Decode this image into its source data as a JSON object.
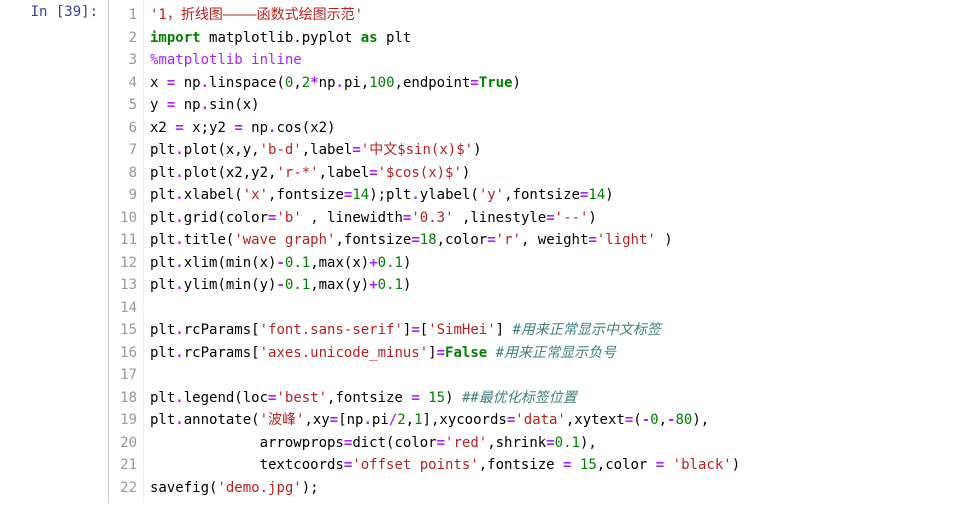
{
  "prompt": {
    "label": "In [39]:"
  },
  "gutter": [
    "1",
    "2",
    "3",
    "4",
    "5",
    "6",
    "7",
    "8",
    "9",
    "10",
    "11",
    "12",
    "13",
    "14",
    "15",
    "16",
    "17",
    "18",
    "19",
    "20",
    "21",
    "22"
  ],
  "lines": [
    [
      {
        "t": "'1，折线图————函数式绘图示范'",
        "c": "tok-str"
      }
    ],
    [
      {
        "t": "import",
        "c": "tok-kw"
      },
      {
        "t": " "
      },
      {
        "t": "matplotlib.pyplot",
        "c": "tok-name"
      },
      {
        "t": " "
      },
      {
        "t": "as",
        "c": "tok-kw"
      },
      {
        "t": " "
      },
      {
        "t": "plt",
        "c": "tok-name"
      }
    ],
    [
      {
        "t": "%",
        "c": "tok-mag"
      },
      {
        "t": "matplotlib",
        "c": "tok-mag"
      },
      {
        "t": " inline",
        "c": "tok-mag"
      }
    ],
    [
      {
        "t": "x "
      },
      {
        "t": "=",
        "c": "tok-op"
      },
      {
        "t": " np"
      },
      {
        "t": ".",
        "c": "tok-op"
      },
      {
        "t": "linspace("
      },
      {
        "t": "0",
        "c": "tok-num"
      },
      {
        "t": ","
      },
      {
        "t": "2",
        "c": "tok-num"
      },
      {
        "t": "*",
        "c": "tok-op"
      },
      {
        "t": "np"
      },
      {
        "t": ".",
        "c": "tok-op"
      },
      {
        "t": "pi,"
      },
      {
        "t": "100",
        "c": "tok-num"
      },
      {
        "t": ",endpoint"
      },
      {
        "t": "=",
        "c": "tok-op"
      },
      {
        "t": "True",
        "c": "tok-bool"
      },
      {
        "t": ")"
      }
    ],
    [
      {
        "t": "y "
      },
      {
        "t": "=",
        "c": "tok-op"
      },
      {
        "t": " np"
      },
      {
        "t": ".",
        "c": "tok-op"
      },
      {
        "t": "sin(x)"
      }
    ],
    [
      {
        "t": "x2 "
      },
      {
        "t": "=",
        "c": "tok-op"
      },
      {
        "t": " x;y2 "
      },
      {
        "t": "=",
        "c": "tok-op"
      },
      {
        "t": " np"
      },
      {
        "t": ".",
        "c": "tok-op"
      },
      {
        "t": "cos(x2)"
      }
    ],
    [
      {
        "t": "plt"
      },
      {
        "t": ".",
        "c": "tok-op"
      },
      {
        "t": "plot(x,y,"
      },
      {
        "t": "'b-d'",
        "c": "tok-str"
      },
      {
        "t": ",label"
      },
      {
        "t": "=",
        "c": "tok-op"
      },
      {
        "t": "'中文$sin(x)$'",
        "c": "tok-str"
      },
      {
        "t": ")"
      }
    ],
    [
      {
        "t": "plt"
      },
      {
        "t": ".",
        "c": "tok-op"
      },
      {
        "t": "plot(x2,y2,"
      },
      {
        "t": "'r-*'",
        "c": "tok-str"
      },
      {
        "t": ",label"
      },
      {
        "t": "=",
        "c": "tok-op"
      },
      {
        "t": "'$cos(x)$'",
        "c": "tok-str"
      },
      {
        "t": ")"
      }
    ],
    [
      {
        "t": "plt"
      },
      {
        "t": ".",
        "c": "tok-op"
      },
      {
        "t": "xlabel("
      },
      {
        "t": "'x'",
        "c": "tok-str"
      },
      {
        "t": ",fontsize"
      },
      {
        "t": "=",
        "c": "tok-op"
      },
      {
        "t": "14",
        "c": "tok-num"
      },
      {
        "t": ");plt"
      },
      {
        "t": ".",
        "c": "tok-op"
      },
      {
        "t": "ylabel("
      },
      {
        "t": "'y'",
        "c": "tok-str"
      },
      {
        "t": ",fontsize"
      },
      {
        "t": "=",
        "c": "tok-op"
      },
      {
        "t": "14",
        "c": "tok-num"
      },
      {
        "t": ")"
      }
    ],
    [
      {
        "t": "plt"
      },
      {
        "t": ".",
        "c": "tok-op"
      },
      {
        "t": "grid(color"
      },
      {
        "t": "=",
        "c": "tok-op"
      },
      {
        "t": "'b'",
        "c": "tok-str"
      },
      {
        "t": " , linewidth"
      },
      {
        "t": "=",
        "c": "tok-op"
      },
      {
        "t": "'0.3'",
        "c": "tok-str"
      },
      {
        "t": " ,linestyle"
      },
      {
        "t": "=",
        "c": "tok-op"
      },
      {
        "t": "'--'",
        "c": "tok-str"
      },
      {
        "t": ")"
      }
    ],
    [
      {
        "t": "plt"
      },
      {
        "t": ".",
        "c": "tok-op"
      },
      {
        "t": "title("
      },
      {
        "t": "'wave graph'",
        "c": "tok-str"
      },
      {
        "t": ",fontsize"
      },
      {
        "t": "=",
        "c": "tok-op"
      },
      {
        "t": "18",
        "c": "tok-num"
      },
      {
        "t": ",color"
      },
      {
        "t": "=",
        "c": "tok-op"
      },
      {
        "t": "'r'",
        "c": "tok-str"
      },
      {
        "t": ", weight"
      },
      {
        "t": "=",
        "c": "tok-op"
      },
      {
        "t": "'light'",
        "c": "tok-str"
      },
      {
        "t": " )"
      }
    ],
    [
      {
        "t": "plt"
      },
      {
        "t": ".",
        "c": "tok-op"
      },
      {
        "t": "xlim(min(x)"
      },
      {
        "t": "-",
        "c": "tok-op"
      },
      {
        "t": "0.1",
        "c": "tok-num"
      },
      {
        "t": ",max(x)"
      },
      {
        "t": "+",
        "c": "tok-op"
      },
      {
        "t": "0.1",
        "c": "tok-num"
      },
      {
        "t": ")"
      }
    ],
    [
      {
        "t": "plt"
      },
      {
        "t": ".",
        "c": "tok-op"
      },
      {
        "t": "ylim(min(y)"
      },
      {
        "t": "-",
        "c": "tok-op"
      },
      {
        "t": "0.1",
        "c": "tok-num"
      },
      {
        "t": ",max(y)"
      },
      {
        "t": "+",
        "c": "tok-op"
      },
      {
        "t": "0.1",
        "c": "tok-num"
      },
      {
        "t": ")"
      }
    ],
    [
      {
        "t": " "
      }
    ],
    [
      {
        "t": "plt"
      },
      {
        "t": ".",
        "c": "tok-op"
      },
      {
        "t": "rcParams["
      },
      {
        "t": "'font.sans-serif'",
        "c": "tok-str"
      },
      {
        "t": "]"
      },
      {
        "t": "=",
        "c": "tok-op"
      },
      {
        "t": "["
      },
      {
        "t": "'SimHei'",
        "c": "tok-str"
      },
      {
        "t": "] "
      },
      {
        "t": "#用来正常显示中文标签",
        "c": "tok-cmt"
      }
    ],
    [
      {
        "t": "plt"
      },
      {
        "t": ".",
        "c": "tok-op"
      },
      {
        "t": "rcParams["
      },
      {
        "t": "'axes.unicode_minus'",
        "c": "tok-str"
      },
      {
        "t": "]"
      },
      {
        "t": "=",
        "c": "tok-op"
      },
      {
        "t": "False",
        "c": "tok-bool"
      },
      {
        "t": " "
      },
      {
        "t": "#用来正常显示负号",
        "c": "tok-cmt"
      }
    ],
    [
      {
        "t": " "
      }
    ],
    [
      {
        "t": "plt"
      },
      {
        "t": ".",
        "c": "tok-op"
      },
      {
        "t": "legend(loc"
      },
      {
        "t": "=",
        "c": "tok-op"
      },
      {
        "t": "'best'",
        "c": "tok-str"
      },
      {
        "t": ",fontsize "
      },
      {
        "t": "=",
        "c": "tok-op"
      },
      {
        "t": " "
      },
      {
        "t": "15",
        "c": "tok-num"
      },
      {
        "t": ") "
      },
      {
        "t": "##最优化标签位置",
        "c": "tok-cmt"
      }
    ],
    [
      {
        "t": "plt"
      },
      {
        "t": ".",
        "c": "tok-op"
      },
      {
        "t": "annotate("
      },
      {
        "t": "'波峰'",
        "c": "tok-str"
      },
      {
        "t": ",xy"
      },
      {
        "t": "=",
        "c": "tok-op"
      },
      {
        "t": "[np"
      },
      {
        "t": ".",
        "c": "tok-op"
      },
      {
        "t": "pi"
      },
      {
        "t": "/",
        "c": "tok-op"
      },
      {
        "t": "2",
        "c": "tok-num"
      },
      {
        "t": ","
      },
      {
        "t": "1",
        "c": "tok-num"
      },
      {
        "t": "],xycoords"
      },
      {
        "t": "=",
        "c": "tok-op"
      },
      {
        "t": "'data'",
        "c": "tok-str"
      },
      {
        "t": ",xytext"
      },
      {
        "t": "=",
        "c": "tok-op"
      },
      {
        "t": "("
      },
      {
        "t": "-",
        "c": "tok-op"
      },
      {
        "t": "0",
        "c": "tok-num"
      },
      {
        "t": ","
      },
      {
        "t": "-",
        "c": "tok-op"
      },
      {
        "t": "80",
        "c": "tok-num"
      },
      {
        "t": "),"
      }
    ],
    [
      {
        "t": "             arrowprops"
      },
      {
        "t": "=",
        "c": "tok-op"
      },
      {
        "t": "dict(color"
      },
      {
        "t": "=",
        "c": "tok-op"
      },
      {
        "t": "'red'",
        "c": "tok-str"
      },
      {
        "t": ",shrink"
      },
      {
        "t": "=",
        "c": "tok-op"
      },
      {
        "t": "0.1",
        "c": "tok-num"
      },
      {
        "t": "),"
      }
    ],
    [
      {
        "t": "             textcoords"
      },
      {
        "t": "=",
        "c": "tok-op"
      },
      {
        "t": "'offset points'",
        "c": "tok-str"
      },
      {
        "t": ",fontsize "
      },
      {
        "t": "=",
        "c": "tok-op"
      },
      {
        "t": " "
      },
      {
        "t": "15",
        "c": "tok-num"
      },
      {
        "t": ",color "
      },
      {
        "t": "=",
        "c": "tok-op"
      },
      {
        "t": " "
      },
      {
        "t": "'black'",
        "c": "tok-str"
      },
      {
        "t": ")"
      }
    ],
    [
      {
        "t": "savefig("
      },
      {
        "t": "'demo.jpg'",
        "c": "tok-str"
      },
      {
        "t": ");"
      }
    ]
  ]
}
